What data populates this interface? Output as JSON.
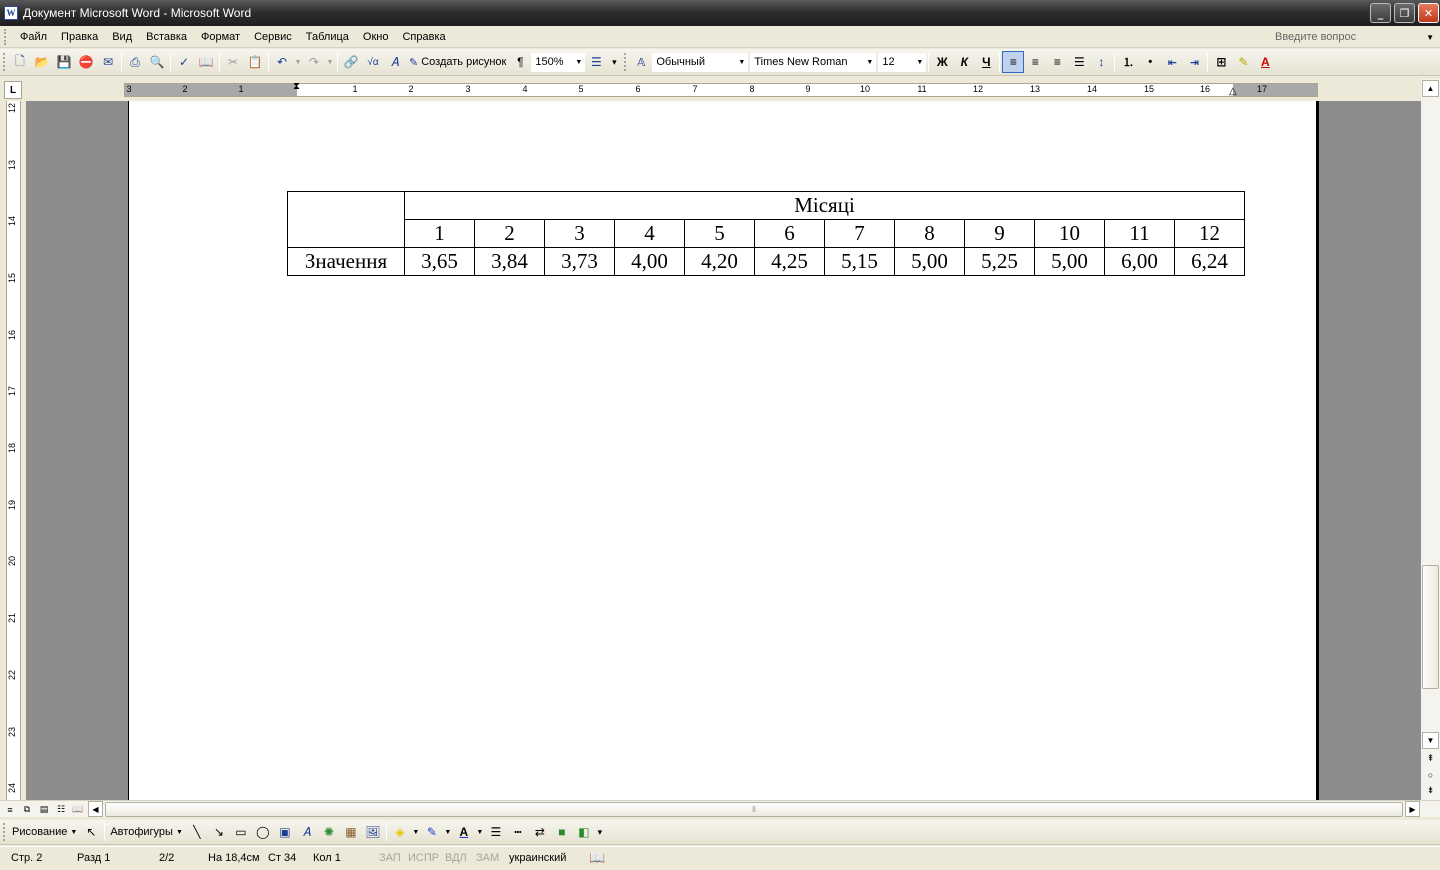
{
  "window": {
    "title": "Документ Microsoft Word - Microsoft Word",
    "app_icon": "W"
  },
  "menu": {
    "items": [
      "Файл",
      "Правка",
      "Вид",
      "Вставка",
      "Формат",
      "Сервис",
      "Таблица",
      "Окно",
      "Справка"
    ],
    "help_placeholder": "Введите вопрос"
  },
  "toolbar": {
    "create_drawing_label": "Создать рисунок",
    "pilcrow": "¶",
    "zoom": "150%",
    "style": "Обычный",
    "font": "Times New Roman",
    "font_size": "12",
    "bold": "Ж",
    "italic": "К",
    "underline": "Ч"
  },
  "ruler": {
    "horizontal_labels": [
      "3",
      "2",
      "1",
      "1",
      "2",
      "3",
      "4",
      "5",
      "6",
      "7",
      "8",
      "9",
      "10",
      "11",
      "12",
      "13",
      "14",
      "15",
      "16",
      "17"
    ],
    "vertical_labels": [
      "12",
      "13",
      "14",
      "15",
      "16",
      "17",
      "18",
      "19",
      "20",
      "21",
      "22",
      "23",
      "24"
    ],
    "tab_selector": "L"
  },
  "document": {
    "table": {
      "group_header": "Місяці",
      "months": [
        "1",
        "2",
        "3",
        "4",
        "5",
        "6",
        "7",
        "8",
        "9",
        "10",
        "11",
        "12"
      ],
      "row_label": "Значення",
      "values": [
        "3,65",
        "3,84",
        "3,73",
        "4,00",
        "4,20",
        "4,25",
        "5,15",
        "5,00",
        "5,25",
        "5,00",
        "6,00",
        "6,24"
      ]
    }
  },
  "drawing_toolbar": {
    "drawing_label": "Рисование",
    "autoshapes_label": "Автофигуры"
  },
  "status": {
    "page": "Стр. 2",
    "section": "Разд 1",
    "page_of": "2/2",
    "at": "На 18,4см",
    "line": "Ст 34",
    "col": "Кол 1",
    "rec": "ЗАП",
    "trk": "ИСПР",
    "ext": "ВДЛ",
    "ovr": "ЗАМ",
    "language": "украинский"
  }
}
